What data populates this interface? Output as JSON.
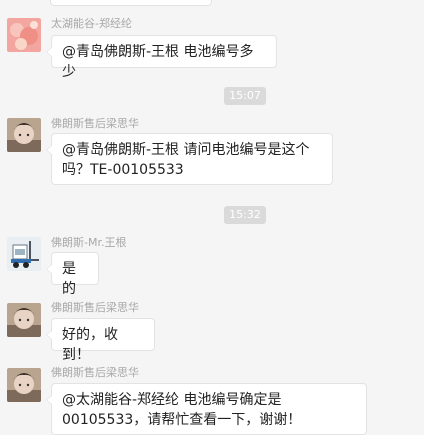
{
  "messages": [
    {
      "sender": "太湖能谷-郑经纶",
      "avatar_icon": "pink-flower-avatar-icon",
      "text": "@青岛佛朗斯-王根 电池编号多少"
    },
    {
      "sender": "佛朗斯售后梁思华",
      "avatar_icon": "person-photo-avatar-icon",
      "text": "@青岛佛朗斯-王根 请问电池编号是这个吗？TE-00105533"
    },
    {
      "sender": "佛朗斯-Mr.王根",
      "avatar_icon": "forklift-avatar-icon",
      "text": "是的"
    },
    {
      "sender": "佛朗斯售后梁思华",
      "avatar_icon": "person-photo-avatar-icon",
      "text": "好的，收到！"
    },
    {
      "sender": "佛朗斯售后梁思华",
      "avatar_icon": "person-photo-avatar-icon",
      "text": "@太湖能谷-郑经纶 电池编号确定是00105533，请帮忙查看一下，谢谢！"
    }
  ],
  "timestamps": [
    "15:07",
    "15:32"
  ],
  "colors": {
    "background": "#f5f5f5",
    "bubble": "#ffffff",
    "name": "#a8a8a8",
    "time_badge": "#dadada"
  }
}
